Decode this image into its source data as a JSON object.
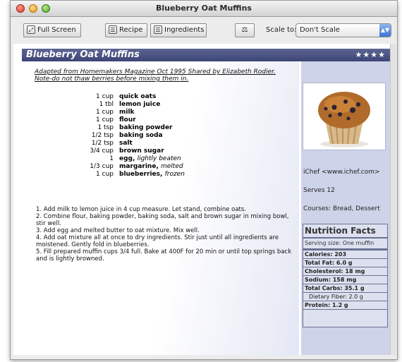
{
  "window": {
    "title": "Blueberry Oat Muffins"
  },
  "toolbar": {
    "full_screen_label": "Full Screen",
    "recipe_label": "Recipe",
    "ingredients_label": "Ingredients",
    "scale_label": "Scale to:",
    "scale_value": "Don't Scale"
  },
  "recipe": {
    "title": "Blueberry Oat Muffins",
    "rating": "★★★★",
    "source_line1": "Adapted from Homemakers Magazine Oct 1995 Shared by Elizabeth Rodier.",
    "source_line2": "Note-do not thaw berries before mixing them in.",
    "ingredients": [
      {
        "amount": "1 cup",
        "name": "quick oats",
        "note": ""
      },
      {
        "amount": "1 tbl",
        "name": "lemon juice",
        "note": ""
      },
      {
        "amount": "1 cup",
        "name": "milk",
        "note": ""
      },
      {
        "amount": "1 cup",
        "name": "flour",
        "note": ""
      },
      {
        "amount": "1 tsp",
        "name": "baking powder",
        "note": ""
      },
      {
        "amount": "1/2 tsp",
        "name": "baking soda",
        "note": ""
      },
      {
        "amount": "1/2 tsp",
        "name": "salt",
        "note": ""
      },
      {
        "amount": "3/4 cup",
        "name": "brown sugar",
        "note": ""
      },
      {
        "amount": "1",
        "name": "egg,",
        "note": "lightly beaten"
      },
      {
        "amount": "1/3 cup",
        "name": "margarine,",
        "note": "melted"
      },
      {
        "amount": "1 cup",
        "name": "blueberries,",
        "note": "frozen"
      }
    ],
    "directions": [
      "1. Add milk to lemon juice in 4 cup measure. Let stand, combine oats.",
      "2. Combine flour, baking powder, baking soda, salt and brown sugar in mixing bowl, stir well.",
      "3. Add egg and melted butter to oat mixture. Mix well.",
      "4. Add oat mixture all at once to dry ingredients. Stir just until all ingredients are moistened. Gently fold in blueberries.",
      "5. Fill prepared muffin cups 3/4 full. Bake at 400F for 20 min or until top springs back and is lightly browned."
    ]
  },
  "sidebar": {
    "source": "iChef <www.ichef.com>",
    "serves": "Serves 12",
    "courses": "Courses:  Bread, Dessert"
  },
  "nutrition": {
    "title": "Nutrition Facts",
    "serving": "Serving size: One muffin",
    "rows": [
      {
        "label": "Calories: 203",
        "bold": true,
        "indent": false
      },
      {
        "label": "Total Fat: 6.0 g",
        "bold": true,
        "indent": false
      },
      {
        "label": "Cholesterol: 18 mg",
        "bold": true,
        "indent": false
      },
      {
        "label": "Sodium: 158 mg",
        "bold": true,
        "indent": false
      },
      {
        "label": "Total Carbs: 35.1 g",
        "bold": true,
        "indent": false
      },
      {
        "label": "Dietary Fiber: 2.0 g",
        "bold": false,
        "indent": true
      },
      {
        "label": "Protein: 1.2 g",
        "bold": true,
        "indent": false
      }
    ]
  },
  "colors": {
    "banner": "#4a5283",
    "sidebar": "#cdd3e8"
  }
}
